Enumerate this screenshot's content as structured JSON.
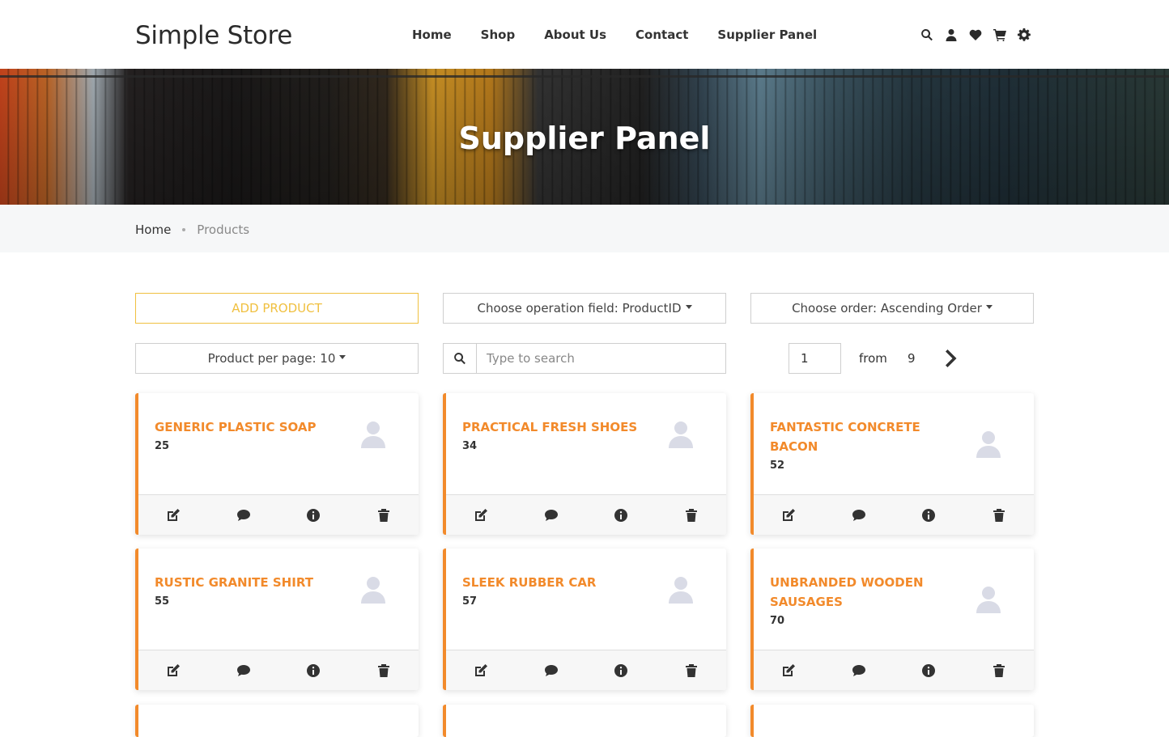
{
  "header": {
    "logo": "Simple Store",
    "nav": [
      "Home",
      "Shop",
      "About Us",
      "Contact",
      "Supplier Panel"
    ],
    "icons": [
      "search-icon",
      "user-icon",
      "heart-icon",
      "cart-icon",
      "gear-icon"
    ]
  },
  "banner": {
    "title": "Supplier Panel"
  },
  "breadcrumb": {
    "home": "Home",
    "current": "Products"
  },
  "controls": {
    "add_product": "ADD PRODUCT",
    "operation_field": "Choose operation field: ProductID",
    "order": "Choose order: Ascending Order",
    "per_page": "Product per page: 10",
    "search_placeholder": "Type to search",
    "page_value": "1",
    "from_label": "from",
    "total_pages": "9"
  },
  "products": [
    {
      "name": "GENERIC PLASTIC SOAP",
      "qty": "25"
    },
    {
      "name": "PRACTICAL FRESH SHOES",
      "qty": "34"
    },
    {
      "name": "FANTASTIC CONCRETE BACON",
      "qty": "52"
    },
    {
      "name": "RUSTIC GRANITE SHIRT",
      "qty": "55"
    },
    {
      "name": "SLEEK RUBBER CAR",
      "qty": "57"
    },
    {
      "name": "UNBRANDED WOODEN SAUSAGES",
      "qty": "70"
    }
  ],
  "card_actions": [
    "edit-icon",
    "comment-icon",
    "info-icon",
    "trash-icon"
  ],
  "colors": {
    "accent": "#f28a2b",
    "add_button": "#f0c040"
  }
}
